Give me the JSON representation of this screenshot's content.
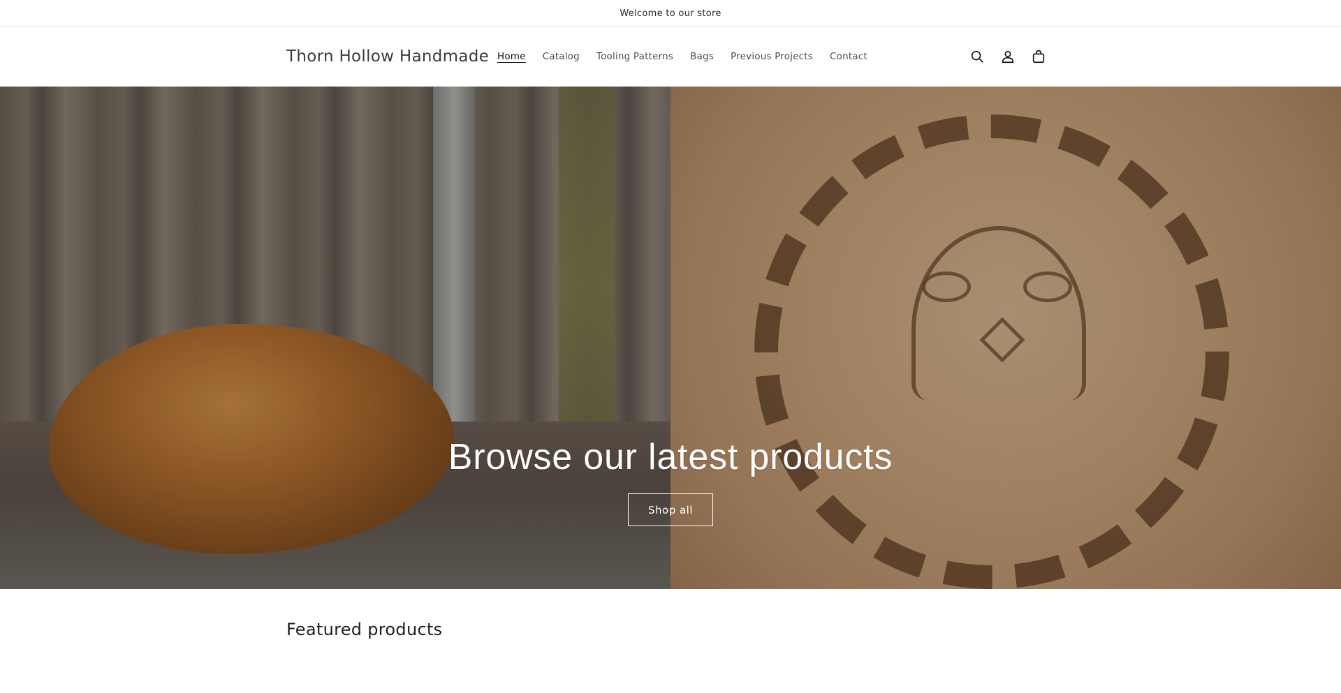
{
  "announcement": {
    "text": "Welcome to our store"
  },
  "header": {
    "logo": "Thorn Hollow Handmade",
    "nav": [
      {
        "label": "Home",
        "active": true
      },
      {
        "label": "Catalog",
        "active": false
      },
      {
        "label": "Tooling Patterns",
        "active": false
      },
      {
        "label": "Bags",
        "active": false
      },
      {
        "label": "Previous Projects",
        "active": false
      },
      {
        "label": "Contact",
        "active": false
      }
    ],
    "icons": [
      "search-icon",
      "account-icon",
      "cart-icon"
    ]
  },
  "hero": {
    "title": "Browse our latest products",
    "button_label": "Shop all",
    "images": [
      "tooled-leather-belt-photo",
      "owl-stamp-leather-photo"
    ]
  },
  "featured": {
    "title": "Featured products"
  },
  "colors": {
    "text": "#121212",
    "border": "#e5e5e5",
    "hero_text": "#ffffff"
  }
}
